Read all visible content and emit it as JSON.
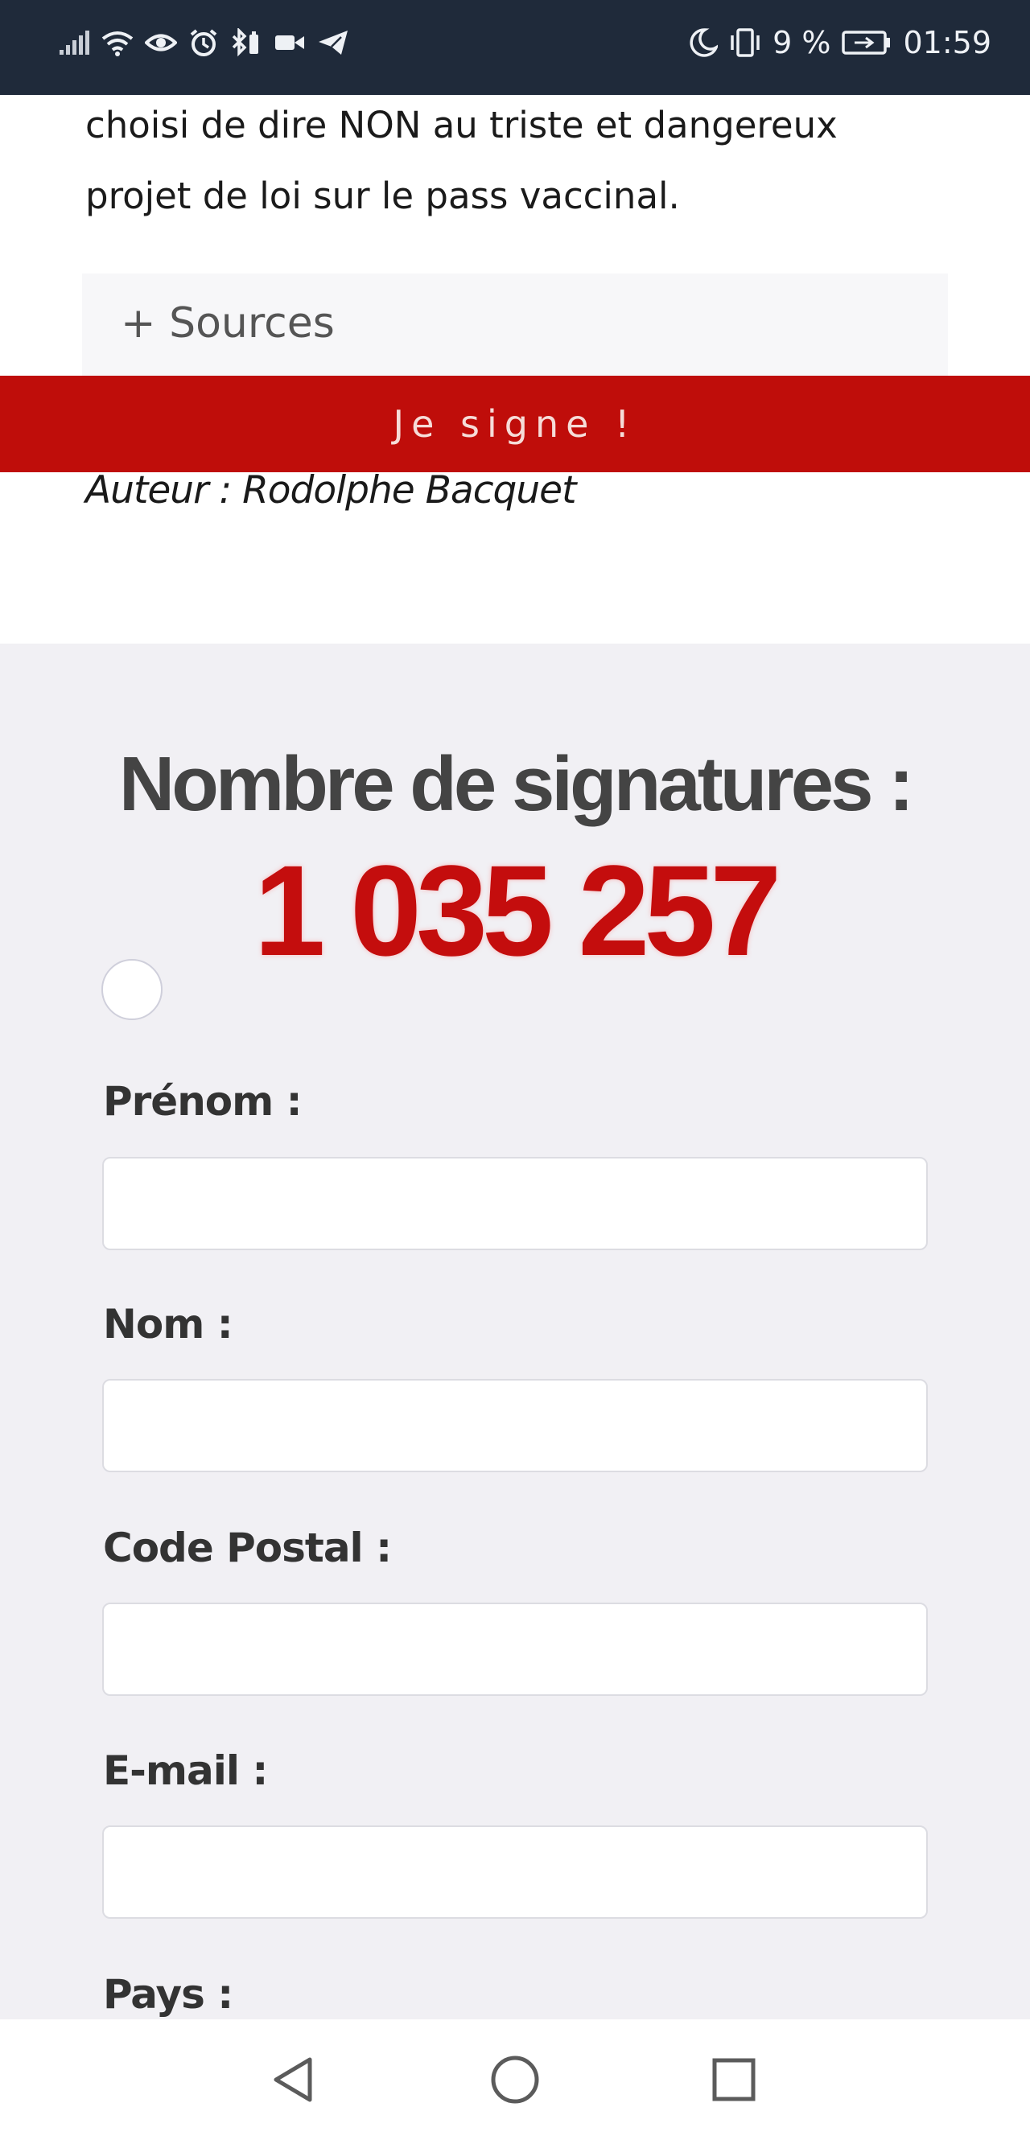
{
  "status_bar": {
    "battery_percent": "9 %",
    "time": "01:59",
    "icons": [
      "signal-icon",
      "wifi-icon",
      "eye-icon",
      "alarm-icon",
      "bluetooth-icon",
      "video-icon",
      "telegram-icon",
      "moon-icon",
      "vibrate-icon",
      "battery-icon"
    ]
  },
  "article": {
    "text_line1": "choisi de dire NON au triste et dangereux",
    "text_line2": "projet de loi sur le pass vaccinal.",
    "sources_label": "+ Sources",
    "author": "Auteur : Rodolphe Bacquet"
  },
  "banner": {
    "sign_label": "Je signe !",
    "color": "#bf0d0a"
  },
  "signatures": {
    "title": "Nombre de signatures :",
    "count": "1 035 257",
    "count_color": "#c40d0d"
  },
  "form": {
    "fields": [
      {
        "label": "Prénom :",
        "value": ""
      },
      {
        "label": "Nom :",
        "value": ""
      },
      {
        "label": "Code Postal :",
        "value": ""
      },
      {
        "label": "E-mail :",
        "value": ""
      },
      {
        "label": "Pays :",
        "value": ""
      }
    ]
  },
  "nav_bar": {
    "icons": [
      "back-icon",
      "home-icon",
      "recents-icon"
    ]
  }
}
